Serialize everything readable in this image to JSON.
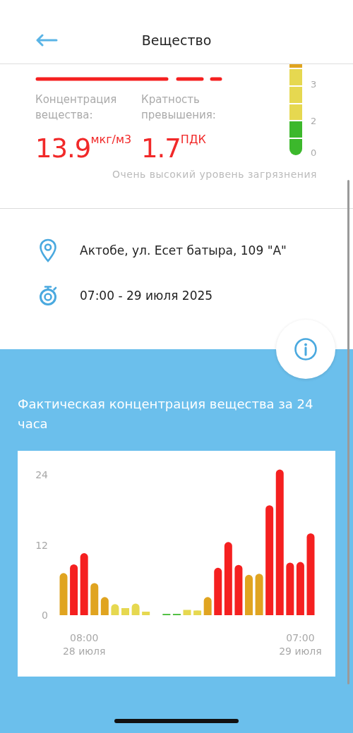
{
  "header": {
    "title": "Вещество"
  },
  "summary": {
    "concentration_label": "Концентрация вещества:",
    "concentration_value": "13.9",
    "concentration_unit": "мкг/м3",
    "ratio_label": "Кратность превышения:",
    "ratio_value": "1.7",
    "ratio_unit": "ПДК",
    "scale": {
      "segments": [
        {
          "color": "#e0a420"
        },
        {
          "color": "#e6d850"
        },
        {
          "color": "#e6d850"
        },
        {
          "color": "#e6d850"
        },
        {
          "color": "#3cb82c"
        },
        {
          "color": "#3cb82c"
        }
      ],
      "labels": [
        "3",
        "2",
        "0"
      ]
    },
    "level_text": "Очень высокий уровень загрязнения"
  },
  "details": [
    {
      "kind": "location",
      "text": "Актобе, ул. Есет батыра, 109 \"А\""
    },
    {
      "kind": "time",
      "text": "07:00 - 29 июля 2025"
    }
  ],
  "chart_section": {
    "title": "Фактическая концентрация вещества за 24 часа",
    "chart_data": {
      "type": "bar",
      "stacked": true,
      "categories": [
        null,
        null,
        "08:00\n28 июля",
        null,
        null,
        null,
        null,
        null,
        null,
        null,
        null,
        null,
        null,
        null,
        null,
        null,
        null,
        null,
        null,
        null,
        null,
        null,
        null,
        "07:00\n29 июля",
        null
      ],
      "ylim": [
        0,
        25.5
      ],
      "yticks": [
        0,
        12,
        24
      ],
      "series": [
        {
          "color": "#f52020",
          "values": [
            null,
            8.7,
            10.6,
            null,
            null,
            null,
            null,
            null,
            null,
            null,
            null,
            null,
            null,
            null,
            null,
            8.1,
            12.5,
            8.6,
            null,
            null,
            18.8,
            24.9,
            9.0,
            9.1,
            14.0
          ]
        },
        {
          "color": "#e0a420",
          "values": [
            7.2,
            null,
            null,
            5.5,
            3.1,
            null,
            null,
            null,
            null,
            null,
            null,
            null,
            null,
            null,
            3.1,
            null,
            null,
            null,
            6.9,
            7.1,
            null,
            null,
            null,
            null,
            null
          ]
        },
        {
          "color": "#e6d850",
          "values": [
            null,
            null,
            null,
            null,
            null,
            1.9,
            1.2,
            2.0,
            0.6,
            null,
            null,
            null,
            0.9,
            0.8,
            null,
            null,
            null,
            null,
            null,
            null,
            null,
            null,
            null,
            null,
            null
          ]
        },
        {
          "color": "#3cb82c",
          "values": [
            null,
            null,
            null,
            null,
            null,
            null,
            null,
            null,
            null,
            null,
            0.2,
            0.2,
            null,
            null,
            null,
            null,
            null,
            null,
            null,
            null,
            null,
            null,
            null,
            null,
            null
          ]
        }
      ]
    }
  }
}
